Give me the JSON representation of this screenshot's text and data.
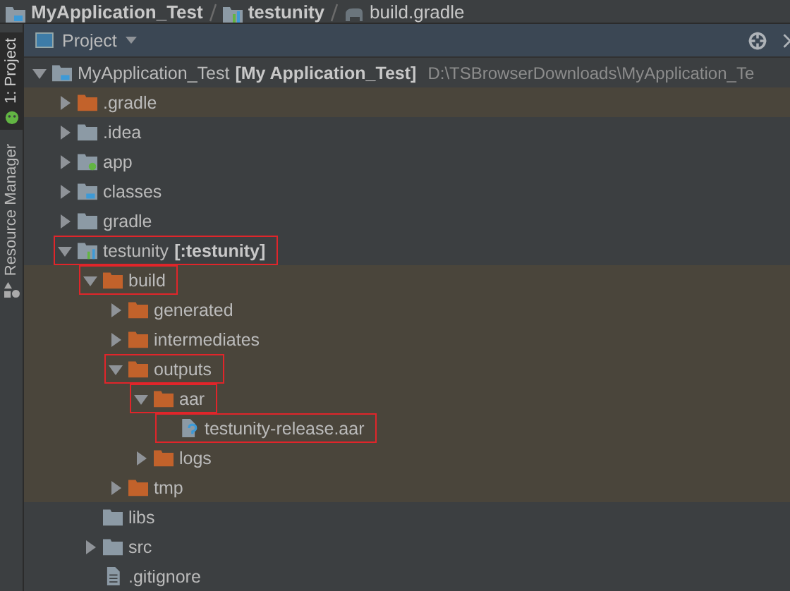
{
  "breadcrumb": [
    {
      "label": "MyApplication_Test",
      "kind": "project"
    },
    {
      "label": "testunity",
      "kind": "module"
    },
    {
      "label": "build.gradle",
      "kind": "gradle"
    }
  ],
  "tool_strip": [
    {
      "label": "1: Project",
      "selected": true,
      "kind": "project"
    },
    {
      "label": "Resource Manager",
      "selected": false,
      "kind": "resources"
    }
  ],
  "panel": {
    "title": "Project"
  },
  "tree": [
    {
      "name": "MyApplication_Test",
      "module": "[My Application_Test]",
      "path": "D:\\TSBrowserDownloads\\MyApplication_Te",
      "kind": "project",
      "expanded": true,
      "excluded": false,
      "outlined": false,
      "children": [
        {
          "name": ".gradle",
          "kind": "folder",
          "expanded": false,
          "excluded": true,
          "outlined": false
        },
        {
          "name": ".idea",
          "kind": "folder",
          "expanded": false,
          "excluded": false,
          "outlined": false
        },
        {
          "name": "app",
          "kind": "app-module",
          "expanded": false,
          "excluded": false,
          "outlined": false
        },
        {
          "name": "classes",
          "kind": "java-folder",
          "expanded": false,
          "excluded": false,
          "outlined": false
        },
        {
          "name": "gradle",
          "kind": "folder",
          "expanded": false,
          "excluded": false,
          "outlined": false
        },
        {
          "name": "testunity",
          "module": "[:testunity]",
          "kind": "module",
          "expanded": true,
          "excluded": false,
          "outlined": true,
          "children": [
            {
              "name": "build",
              "kind": "folder",
              "expanded": true,
              "excluded": true,
              "outlined": true,
              "children": [
                {
                  "name": "generated",
                  "kind": "folder",
                  "expanded": false,
                  "excluded": true,
                  "outlined": false
                },
                {
                  "name": "intermediates",
                  "kind": "folder",
                  "expanded": false,
                  "excluded": true,
                  "outlined": false
                },
                {
                  "name": "outputs",
                  "kind": "folder",
                  "expanded": true,
                  "excluded": true,
                  "outlined": true,
                  "children": [
                    {
                      "name": "aar",
                      "kind": "folder",
                      "expanded": true,
                      "excluded": true,
                      "outlined": true,
                      "children": [
                        {
                          "name": "testunity-release.aar",
                          "kind": "unknown-file",
                          "excluded": true,
                          "outlined": true
                        }
                      ]
                    },
                    {
                      "name": "logs",
                      "kind": "folder",
                      "expanded": false,
                      "excluded": true,
                      "outlined": false
                    }
                  ]
                },
                {
                  "name": "tmp",
                  "kind": "folder",
                  "expanded": false,
                  "excluded": true,
                  "outlined": false
                }
              ]
            },
            {
              "name": "libs",
              "kind": "folder",
              "excluded": false,
              "outlined": false
            },
            {
              "name": "src",
              "kind": "folder",
              "expanded": false,
              "excluded": false,
              "outlined": false
            },
            {
              "name": ".gitignore",
              "kind": "text-file",
              "excluded": false,
              "outlined": false
            }
          ]
        }
      ]
    }
  ]
}
